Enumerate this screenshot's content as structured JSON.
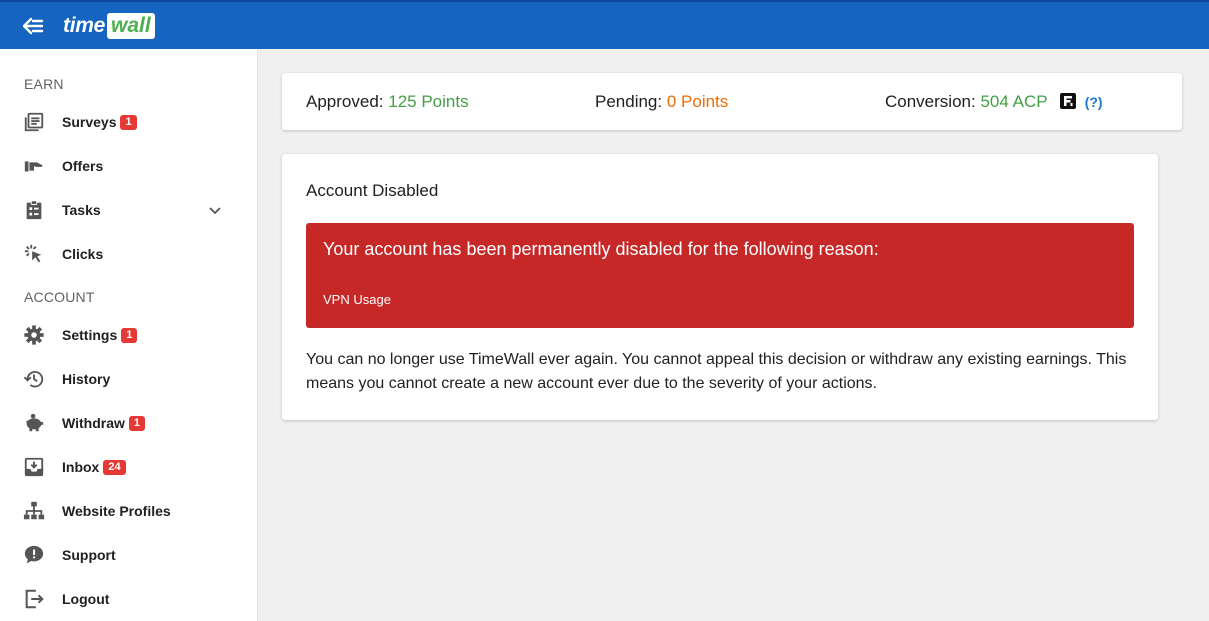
{
  "header": {
    "logo_time": "time",
    "logo_wall": "wall",
    "brand_color": "#1565c0"
  },
  "sidebar": {
    "earn_label": "EARN",
    "account_label": "ACCOUNT",
    "items": [
      {
        "label": "Surveys",
        "icon": "surveys-list-icon",
        "badge": "1"
      },
      {
        "label": "Offers",
        "icon": "offers-hand-icon",
        "badge": ""
      },
      {
        "label": "Tasks",
        "icon": "clipboard-tasks-icon",
        "badge": ""
      },
      {
        "label": "Clicks",
        "icon": "cursor-click-icon",
        "badge": ""
      },
      {
        "label": "Settings",
        "icon": "gear-icon",
        "badge": "1"
      },
      {
        "label": "History",
        "icon": "history-clock-icon",
        "badge": ""
      },
      {
        "label": "Withdraw",
        "icon": "piggy-bank-icon",
        "badge": "1"
      },
      {
        "label": "Inbox",
        "icon": "inbox-tray-icon",
        "badge": "24"
      },
      {
        "label": "Website Profiles",
        "icon": "sitemap-icon",
        "badge": ""
      },
      {
        "label": "Support",
        "icon": "chat-alert-icon",
        "badge": ""
      },
      {
        "label": "Logout",
        "icon": "logout-icon",
        "badge": ""
      }
    ]
  },
  "stats": {
    "approved_label": "Approved:",
    "approved_value": "125 Points",
    "pending_label": "Pending:",
    "pending_value": "0 Points",
    "conversion_label": "Conversion:",
    "conversion_value": "504 ACP",
    "help": "(?)"
  },
  "notice": {
    "title": "Account Disabled",
    "alert_heading": "Your account has been permanently disabled for the following reason:",
    "alert_reason": "VPN Usage",
    "body": "You can no longer use TimeWall ever again. You cannot appeal this decision or withdraw any existing earnings. This means you cannot create a new account ever due to the severity of your actions."
  },
  "colors": {
    "approved": "#43a047",
    "pending": "#ef6c00",
    "alert_bg": "#c62828",
    "badge": "#e53935"
  }
}
